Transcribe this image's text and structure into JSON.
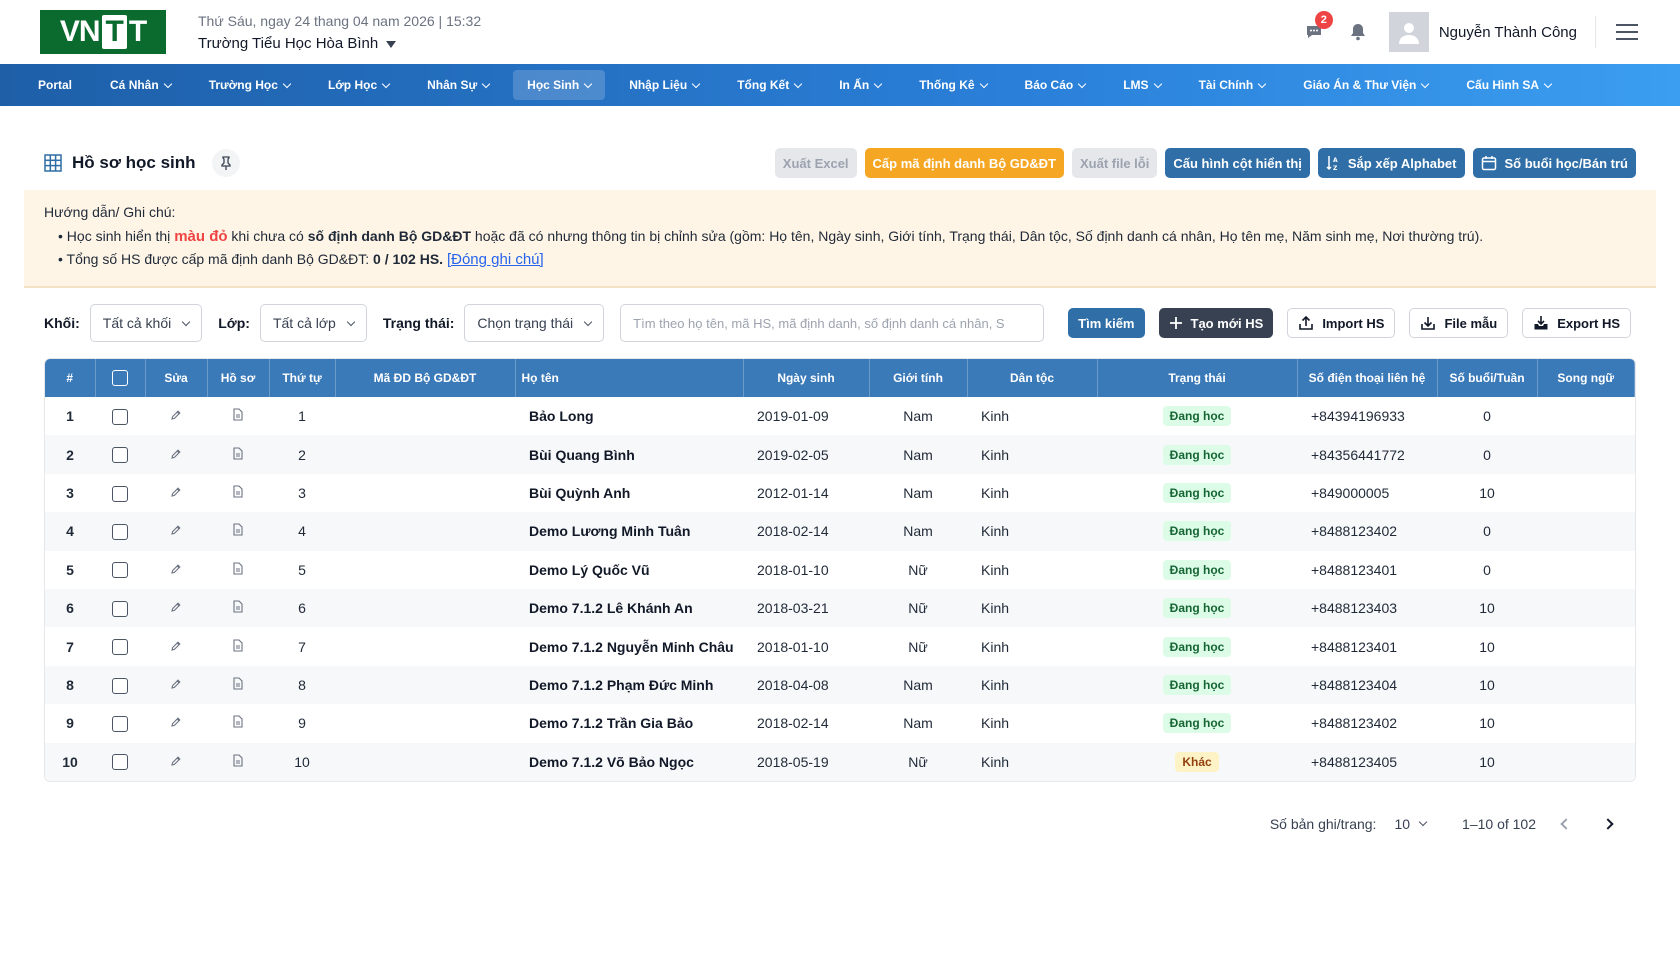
{
  "header": {
    "logo_text": "VNTT",
    "date_line": "Thứ Sáu, ngay 24 thang 04 nam 2026 | 15:32",
    "school": "Trường Tiểu Học Hòa Bình",
    "chat_badge": "2",
    "user_name": "Nguyễn Thành Công"
  },
  "nav": [
    {
      "label": "Portal",
      "has_menu": false
    },
    {
      "label": "Cá Nhân",
      "has_menu": true
    },
    {
      "label": "Trường Học",
      "has_menu": true
    },
    {
      "label": "Lớp Học",
      "has_menu": true
    },
    {
      "label": "Nhân Sự",
      "has_menu": true
    },
    {
      "label": "Học Sinh",
      "has_menu": true,
      "active": true
    },
    {
      "label": "Nhập Liệu",
      "has_menu": true
    },
    {
      "label": "Tổng Kết",
      "has_menu": true
    },
    {
      "label": "In Ấn",
      "has_menu": true
    },
    {
      "label": "Thống Kê",
      "has_menu": true
    },
    {
      "label": "Báo Cáo",
      "has_menu": true
    },
    {
      "label": "LMS",
      "has_menu": true
    },
    {
      "label": "Tài Chính",
      "has_menu": true
    },
    {
      "label": "Giáo Án & Thư Viện",
      "has_menu": true
    },
    {
      "label": "Cấu Hình SA",
      "has_menu": true
    }
  ],
  "page": {
    "title": "Hồ sơ học sinh",
    "actions": {
      "export_excel": "Xuất Excel",
      "issue_id": "Cấp mã định danh Bộ GD&ĐT",
      "export_error": "Xuất file lỗi",
      "column_config": "Cấu hình cột hiển thị",
      "sort_alpha": "Sắp xếp Alphabet",
      "sessions": "Số buổi học/Bán trú"
    }
  },
  "note": {
    "title": "Hướng dẫn/ Ghi chú:",
    "line1_pre": "• Học sinh hiển thị ",
    "line1_red": "màu đỏ",
    "line1_mid": " khi chưa có ",
    "line1_bold": "số định danh Bộ GD&ĐT",
    "line1_post": " hoặc đã có nhưng thông tin bị chỉnh sửa (gồm: Họ tên, Ngày sinh, Giới tính, Trạng thái, Dân tộc, Số định danh cá nhân, Họ tên mẹ, Năm sinh mẹ, Nơi thường trú).",
    "line2_pre": "• Tổng số HS được cấp mã định danh Bộ GD&ĐT: ",
    "line2_bold": "0 / 102 HS.",
    "line2_link": "[Đóng ghi chú]"
  },
  "filters": {
    "grade_label": "Khối:",
    "grade_value": "Tất cả khối",
    "class_label": "Lớp:",
    "class_value": "Tất cả lớp",
    "status_label": "Trạng thái:",
    "status_value": "Chọn trạng thái",
    "search_placeholder": "Tìm theo họ tên, mã HS, mã định danh, số định danh cá nhân, S",
    "search_btn": "Tìm kiếm",
    "create_btn": "Tạo mới HS",
    "import_btn": "Import HS",
    "template_btn": "File mẫu",
    "export_btn": "Export HS"
  },
  "table": {
    "columns": {
      "idx": "#",
      "edit": "Sửa",
      "profile": "Hồ sơ",
      "order": "Thứ tự",
      "moet_id": "Mã ĐD Bộ GD&ĐT",
      "name": "Họ tên",
      "dob": "Ngày sinh",
      "gender": "Giới tính",
      "ethnicity": "Dân tộc",
      "status": "Trạng thái",
      "phone": "Số điện thoại liên hệ",
      "sessions": "Số buổi/Tuần",
      "bilingual": "Song ngữ"
    },
    "rows": [
      {
        "idx": "1",
        "order": "1",
        "moet_id": "",
        "name": "Bảo Long",
        "dob": "2019-01-09",
        "gender": "Nam",
        "ethnicity": "Kinh",
        "status": "Đang học",
        "status_type": "green",
        "phone": "+84394196933",
        "sessions": "0",
        "bilingual": ""
      },
      {
        "idx": "2",
        "order": "2",
        "moet_id": "",
        "name": "Bùi Quang Bình",
        "dob": "2019-02-05",
        "gender": "Nam",
        "ethnicity": "Kinh",
        "status": "Đang học",
        "status_type": "green",
        "phone": "+84356441772",
        "sessions": "0",
        "bilingual": ""
      },
      {
        "idx": "3",
        "order": "3",
        "moet_id": "",
        "name": "Bùi Quỳnh Anh",
        "dob": "2012-01-14",
        "gender": "Nam",
        "ethnicity": "Kinh",
        "status": "Đang học",
        "status_type": "green",
        "phone": "+849000005",
        "sessions": "10",
        "bilingual": ""
      },
      {
        "idx": "4",
        "order": "4",
        "moet_id": "",
        "name": "Demo Lương Minh Tuân",
        "dob": "2018-02-14",
        "gender": "Nam",
        "ethnicity": "Kinh",
        "status": "Đang học",
        "status_type": "green",
        "phone": "+8488123402",
        "sessions": "0",
        "bilingual": ""
      },
      {
        "idx": "5",
        "order": "5",
        "moet_id": "",
        "name": "Demo Lý Quốc Vũ",
        "dob": "2018-01-10",
        "gender": "Nữ",
        "ethnicity": "Kinh",
        "status": "Đang học",
        "status_type": "green",
        "phone": "+8488123401",
        "sessions": "0",
        "bilingual": ""
      },
      {
        "idx": "6",
        "order": "6",
        "moet_id": "",
        "name": "Demo 7.1.2 Lê Khánh An",
        "dob": "2018-03-21",
        "gender": "Nữ",
        "ethnicity": "Kinh",
        "status": "Đang học",
        "status_type": "green",
        "phone": "+8488123403",
        "sessions": "10",
        "bilingual": ""
      },
      {
        "idx": "7",
        "order": "7",
        "moet_id": "",
        "name": "Demo 7.1.2 Nguyễn Minh Châu",
        "dob": "2018-01-10",
        "gender": "Nữ",
        "ethnicity": "Kinh",
        "status": "Đang học",
        "status_type": "green",
        "phone": "+8488123401",
        "sessions": "10",
        "bilingual": ""
      },
      {
        "idx": "8",
        "order": "8",
        "moet_id": "",
        "name": "Demo 7.1.2 Phạm Đức Minh",
        "dob": "2018-04-08",
        "gender": "Nam",
        "ethnicity": "Kinh",
        "status": "Đang học",
        "status_type": "green",
        "phone": "+8488123404",
        "sessions": "10",
        "bilingual": ""
      },
      {
        "idx": "9",
        "order": "9",
        "moet_id": "",
        "name": "Demo 7.1.2 Trần Gia Bảo",
        "dob": "2018-02-14",
        "gender": "Nam",
        "ethnicity": "Kinh",
        "status": "Đang học",
        "status_type": "green",
        "phone": "+8488123402",
        "sessions": "10",
        "bilingual": ""
      },
      {
        "idx": "10",
        "order": "10",
        "moet_id": "",
        "name": "Demo 7.1.2 Võ Bảo Ngọc",
        "dob": "2018-05-19",
        "gender": "Nữ",
        "ethnicity": "Kinh",
        "status": "Khác",
        "status_type": "yellow",
        "phone": "+8488123405",
        "sessions": "10",
        "bilingual": ""
      }
    ]
  },
  "pagination": {
    "per_page_label": "Số bản ghi/trang:",
    "per_page_value": "10",
    "range": "1–10 of 102"
  },
  "colors": {
    "nav_start": "#1e5fa8",
    "nav_end": "#3b9ef0",
    "table_header": "#3b7ab8",
    "accent_orange": "#f5a623",
    "primary_blue": "#2f6ea6"
  }
}
